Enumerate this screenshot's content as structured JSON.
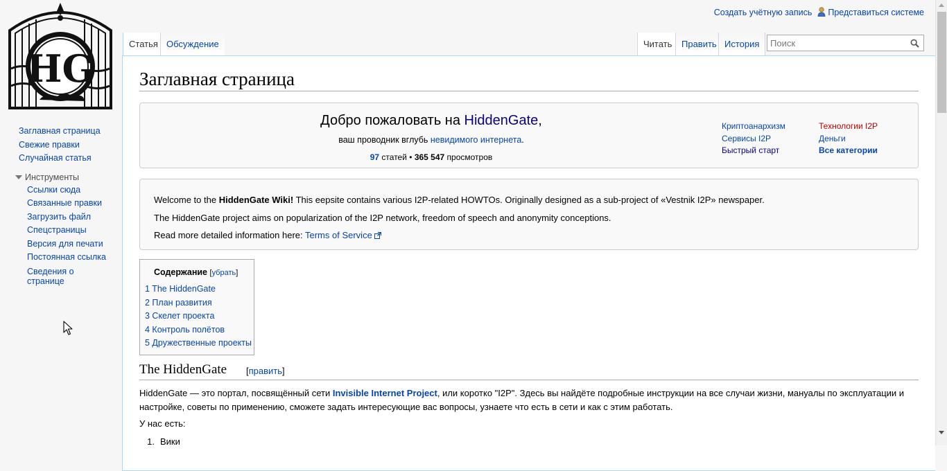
{
  "personal": {
    "create_account": "Создать учётную запись",
    "login": "Представиться системе"
  },
  "sidebar": {
    "nav": [
      {
        "label": "Заглавная страница"
      },
      {
        "label": "Свежие правки"
      },
      {
        "label": "Случайная статья"
      }
    ],
    "tools_heading": "Инструменты",
    "tools": [
      {
        "label": "Ссылки сюда"
      },
      {
        "label": "Связанные правки"
      },
      {
        "label": "Загрузить файл"
      },
      {
        "label": "Спецстраницы"
      },
      {
        "label": "Версия для печати"
      },
      {
        "label": "Постоянная ссылка"
      },
      {
        "label": "Сведения о странице"
      }
    ]
  },
  "tabs": {
    "article": "Статья",
    "discussion": "Обсуждение",
    "view": "Читать",
    "edit": "Править",
    "history": "История"
  },
  "search": {
    "placeholder": "Поиск"
  },
  "page": {
    "title": "Заглавная страница"
  },
  "welcome": {
    "prefix": "Добро пожаловать на ",
    "site_name": "HiddenGate",
    "suffix": ",",
    "sub_prefix": "ваш проводник вглубь ",
    "sub_link": "невидимого интернета",
    "sub_suffix": ".",
    "articles_count": "97",
    "articles_label": " статей • ",
    "views_count": "365 547",
    "views_label": " просмотров",
    "quicklinks": [
      {
        "label": "Криптоанархизм",
        "style": "normal"
      },
      {
        "label": "Сервисы I2P",
        "style": "normal"
      },
      {
        "label": "Быстрый старт",
        "style": "dark"
      },
      {
        "label": "Технологии I2P",
        "style": "red"
      },
      {
        "label": "Деньги",
        "style": "normal"
      },
      {
        "label": "Все категории",
        "style": "bold"
      }
    ]
  },
  "info": {
    "line1_prefix": "Welcome to the ",
    "line1_bold": "HiddenGate Wiki!",
    "line1_suffix": " This eepsite contains various I2P-related HOWTOs. Originally designed as a sub-project of «Vestnik I2P» newspaper.",
    "line2": "The HiddenGate project aims on popularization of the I2P network, freedom of speech and anonymity conceptions.",
    "line3_prefix": "Read more detailed information here: ",
    "line3_link": "Terms of Service"
  },
  "toc": {
    "title": "Содержание",
    "hide_open": "[",
    "hide": "убрать",
    "hide_close": "]",
    "items": [
      {
        "label": "1 The HiddenGate"
      },
      {
        "label": "2 План развития"
      },
      {
        "label": "3 Скелет проекта"
      },
      {
        "label": "4 Контроль полётов"
      },
      {
        "label": "5 Дружественные проекты"
      }
    ]
  },
  "section": {
    "title": "The HiddenGate",
    "edit_open": "[",
    "edit": "править",
    "edit_close": "]"
  },
  "body": {
    "p1_prefix": "HiddenGate — это портал, посвящённый сети ",
    "p1_link": "Invisible Internet Project",
    "p1_suffix": ", или коротко \"I2P\". Здесь вы найдёте подробные инструкции на все случаи жизни, мануалы по эксплуатации и настройке, советы по применению, сможете задать интересующие вас вопросы, узнаете что есть в сети и как с этим работать.",
    "p2": "У нас есть:",
    "list_item_1_num": "1.",
    "list_item_1": "Вики"
  },
  "colors": {
    "link": "#0645ad",
    "redlink": "#ba0000",
    "visited": "#0b0080",
    "border": "#a7d7f9"
  }
}
